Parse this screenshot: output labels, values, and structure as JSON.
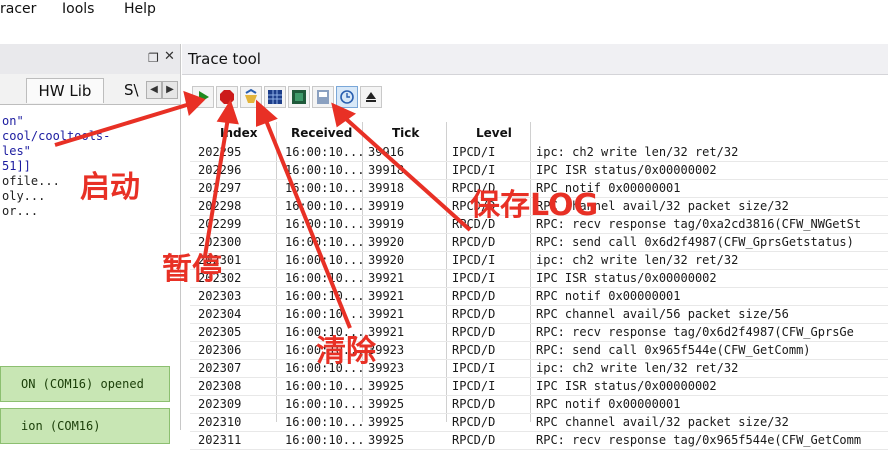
{
  "menubar": {
    "items": [
      "racer",
      "Iools",
      "Help"
    ]
  },
  "left_pane": {
    "tabs": {
      "hwlib": "HW Lib",
      "sw": "S\\"
    },
    "log_lines": [
      "on\"",
      "cool/cooltools-",
      "les\"",
      "",
      "51]]",
      "ofile...",
      "oly...",
      "or..."
    ],
    "status_boxes": [
      "ON (COM16) opened",
      "ion (COM16)"
    ]
  },
  "right_pane": {
    "title": "Trace tool",
    "toolbar": [
      "play-icon",
      "stop-icon",
      "clear-icon",
      "grid-icon",
      "export-icon",
      "save-log-icon",
      "clock-icon",
      "eject-icon"
    ],
    "columns": {
      "index": "Index",
      "received": "Received",
      "tick": "Tick",
      "level": "Level"
    },
    "rows": [
      {
        "index": "202295",
        "received": "16:00:10...",
        "tick": "39916",
        "level": "IPCD/I",
        "msg": "ipc: ch2 write len/32 ret/32"
      },
      {
        "index": "202296",
        "received": "16:00:10...",
        "tick": "39918",
        "level": "IPCD/I",
        "msg": "IPC ISR status/0x00000002"
      },
      {
        "index": "202297",
        "received": "16:00:10...",
        "tick": "39918",
        "level": "RPCD/D",
        "msg": "RPC notif 0x00000001"
      },
      {
        "index": "202298",
        "received": "16:00:10...",
        "tick": "39919",
        "level": "RPCD/D",
        "msg": "RPC channel avail/32 packet size/32"
      },
      {
        "index": "202299",
        "received": "16:00:10...",
        "tick": "39919",
        "level": "RPCD/D",
        "msg": "RPC: recv response tag/0xa2cd3816(CFW_NWGetSt"
      },
      {
        "index": "202300",
        "received": "16:00:10...",
        "tick": "39920",
        "level": "RPCD/D",
        "msg": "RPC: send call 0x6d2f4987(CFW_GprsGetstatus)"
      },
      {
        "index": "202301",
        "received": "16:00:10...",
        "tick": "39920",
        "level": "IPCD/I",
        "msg": "ipc: ch2 write len/32 ret/32"
      },
      {
        "index": "202302",
        "received": "16:00:10...",
        "tick": "39921",
        "level": "IPCD/I",
        "msg": "IPC ISR status/0x00000002"
      },
      {
        "index": "202303",
        "received": "16:00:10...",
        "tick": "39921",
        "level": "RPCD/D",
        "msg": "RPC notif 0x00000001"
      },
      {
        "index": "202304",
        "received": "16:00:10...",
        "tick": "39921",
        "level": "RPCD/D",
        "msg": "RPC channel avail/56 packet size/56"
      },
      {
        "index": "202305",
        "received": "16:00:10...",
        "tick": "39921",
        "level": "RPCD/D",
        "msg": "RPC: recv response tag/0x6d2f4987(CFW_GprsGe"
      },
      {
        "index": "202306",
        "received": "16:00:10...",
        "tick": "39923",
        "level": "RPCD/D",
        "msg": "RPC: send call 0x965f544e(CFW_GetComm)"
      },
      {
        "index": "202307",
        "received": "16:00:10...",
        "tick": "39923",
        "level": "IPCD/I",
        "msg": "ipc: ch2 write len/32 ret/32"
      },
      {
        "index": "202308",
        "received": "16:00:10...",
        "tick": "39925",
        "level": "IPCD/I",
        "msg": "IPC ISR status/0x00000002"
      },
      {
        "index": "202309",
        "received": "16:00:10...",
        "tick": "39925",
        "level": "RPCD/D",
        "msg": "RPC notif 0x00000001"
      },
      {
        "index": "202310",
        "received": "16:00:10...",
        "tick": "39925",
        "level": "RPCD/D",
        "msg": "RPC channel avail/32 packet size/32"
      },
      {
        "index": "202311",
        "received": "16:00:10...",
        "tick": "39925",
        "level": "RPCD/D",
        "msg": "RPC: recv response tag/0x965f544e(CFW_GetComm"
      }
    ]
  },
  "annotations": {
    "start": "启动",
    "pause": "暂停",
    "clear": "清除",
    "save_log": "保存LOG"
  },
  "colors": {
    "annotation": "#e83025",
    "status_green": "#c8e6b4"
  }
}
